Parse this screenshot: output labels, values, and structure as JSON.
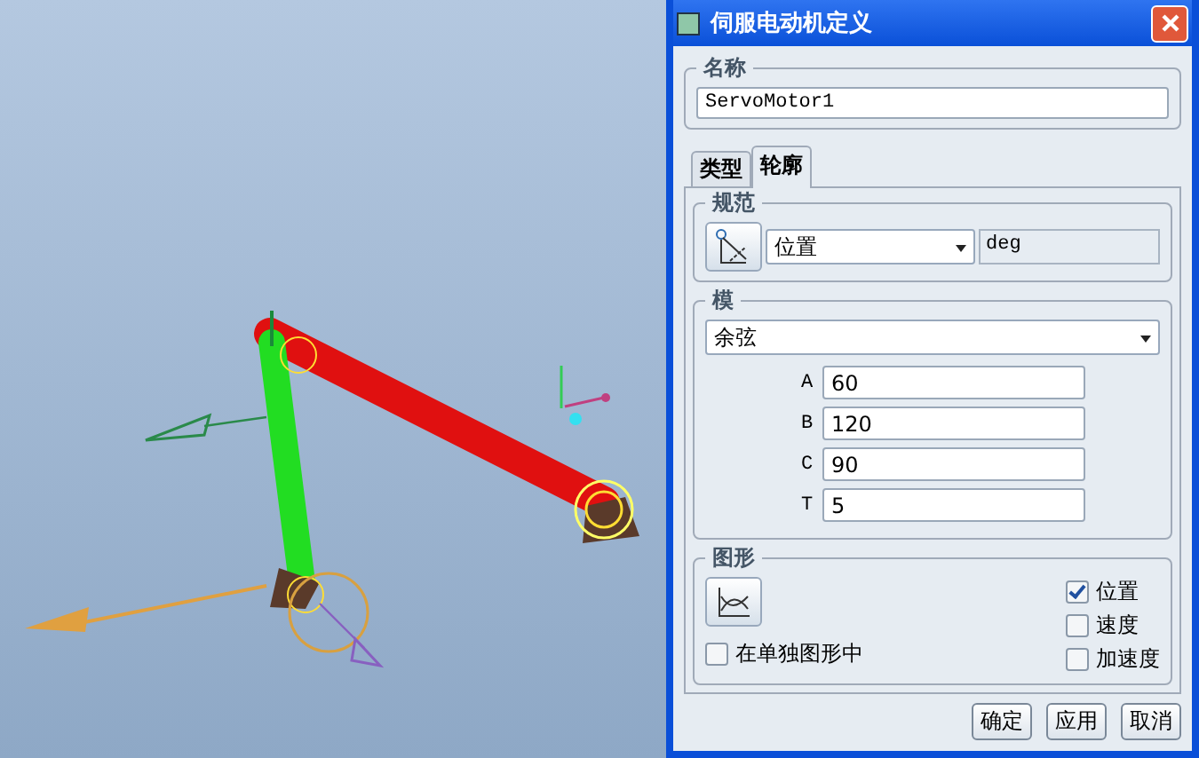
{
  "window": {
    "title": "伺服电动机定义"
  },
  "name_group": {
    "label": "名称",
    "value": "ServoMotor1"
  },
  "tabs": [
    {
      "label": "类型",
      "selected": false
    },
    {
      "label": "轮廓",
      "selected": true
    }
  ],
  "spec_group": {
    "label": "规范",
    "quantity": "位置",
    "unit": "deg"
  },
  "model_group": {
    "label": "模",
    "function": "余弦",
    "params": [
      {
        "label": "A",
        "value": "60"
      },
      {
        "label": "B",
        "value": "120"
      },
      {
        "label": "C",
        "value": "90"
      },
      {
        "label": "T",
        "value": "5"
      }
    ]
  },
  "graph_group": {
    "label": "图形",
    "separate": {
      "label": "在单独图形中",
      "checked": false
    },
    "plots": [
      {
        "label": "位置",
        "checked": true
      },
      {
        "label": "速度",
        "checked": false
      },
      {
        "label": "加速度",
        "checked": false
      }
    ]
  },
  "buttons": [
    "确定",
    "应用",
    "取消"
  ]
}
